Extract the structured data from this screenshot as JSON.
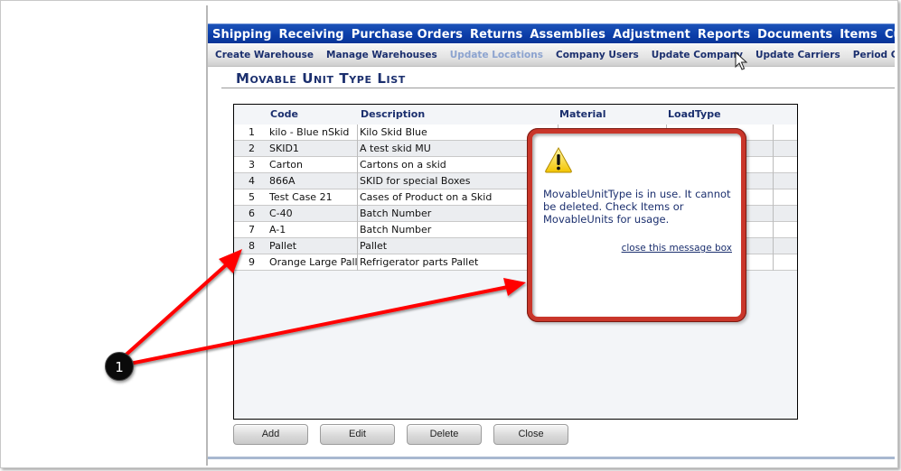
{
  "main_nav": {
    "items": [
      "Shipping",
      "Receiving",
      "Purchase Orders",
      "Returns",
      "Assemblies",
      "Adjustment",
      "Reports",
      "Documents",
      "Items",
      "Custome"
    ]
  },
  "sub_nav": {
    "items": [
      {
        "label": "Create Warehouse",
        "disabled": false
      },
      {
        "label": "Manage Warehouses",
        "disabled": false
      },
      {
        "label": "Update Locations",
        "disabled": true
      },
      {
        "label": "Company Users",
        "disabled": false
      },
      {
        "label": "Update Company",
        "disabled": false
      },
      {
        "label": "Update Carriers",
        "disabled": false
      },
      {
        "label": "Period Close",
        "disabled": false
      }
    ]
  },
  "page": {
    "title": "Movable Unit Type List"
  },
  "grid": {
    "columns": [
      "Code",
      "Description",
      "Material",
      "LoadType"
    ],
    "rows": [
      {
        "num": "1",
        "code": "kilo - Blue nSkid",
        "description": "Kilo Skid Blue",
        "material": "",
        "loadtype": ""
      },
      {
        "num": "2",
        "code": "SKID1",
        "description": "A test skid MU",
        "material": "",
        "loadtype": ""
      },
      {
        "num": "3",
        "code": "Carton",
        "description": "Cartons on a skid",
        "material": "",
        "loadtype": ""
      },
      {
        "num": "4",
        "code": "866A",
        "description": "SKID for special Boxes",
        "material": "",
        "loadtype": ""
      },
      {
        "num": "5",
        "code": "Test Case 21",
        "description": "Cases of Product on a Skid",
        "material": "",
        "loadtype": ""
      },
      {
        "num": "6",
        "code": "C-40",
        "description": "Batch Number",
        "material": "",
        "loadtype": ""
      },
      {
        "num": "7",
        "code": "A-1",
        "description": "Batch Number",
        "material": "",
        "loadtype": ""
      },
      {
        "num": "8",
        "code": "Pallet",
        "description": "Pallet",
        "material": "",
        "loadtype": ""
      },
      {
        "num": "9",
        "code": "Orange Large Pallet",
        "description": "Refrigerator parts Pallet",
        "material": "",
        "loadtype": ""
      }
    ]
  },
  "buttons": {
    "add": "Add",
    "edit": "Edit",
    "delete": "Delete",
    "close": "Close"
  },
  "dialog": {
    "icon": "warning-icon",
    "message": "MovableUnitType is in use. It cannot be deleted. Check Items or MovableUnits for usage.",
    "close_link": "close this message box",
    "border_color": "#c9362a"
  },
  "annotation": {
    "badge_number": "1",
    "arrow_color": "#ff0000"
  }
}
